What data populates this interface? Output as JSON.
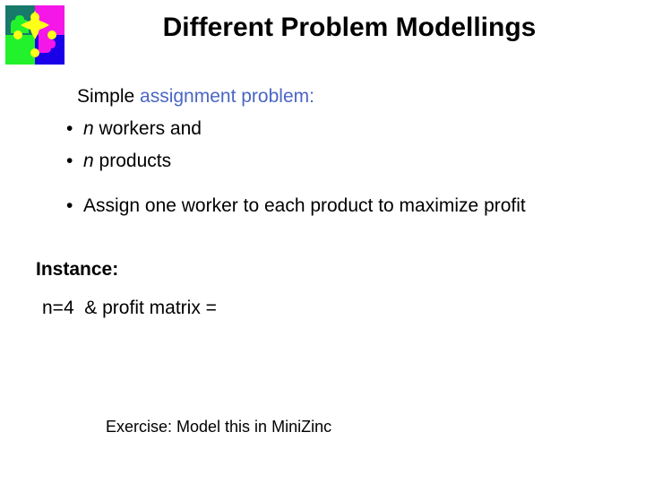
{
  "slide": {
    "title": "Different Problem Modellings",
    "logo": {
      "name": "puzzle-logo",
      "colors": {
        "top_left": "#177a6b",
        "top_right": "#f517e8",
        "bottom_left": "#22f22b",
        "bottom_right": "#1a00e8",
        "center": "#ffff1a"
      }
    },
    "accent_color": "#4a66c4",
    "body": {
      "intro_prefix": "Simple ",
      "intro_highlight": "assignment problem",
      "intro_suffix": ":",
      "bullets": [
        {
          "marker": "•",
          "italic_lead": "n",
          "text": " workers and"
        },
        {
          "marker": "•",
          "italic_lead": "n",
          "text": " products"
        }
      ],
      "objective": {
        "marker": "•",
        "text": "Assign one worker to each product to maximize profit"
      },
      "instance_label": "Instance:",
      "instance_value": "n=4  & profit matrix =",
      "exercise": "Exercise: Model this in MiniZinc"
    }
  }
}
